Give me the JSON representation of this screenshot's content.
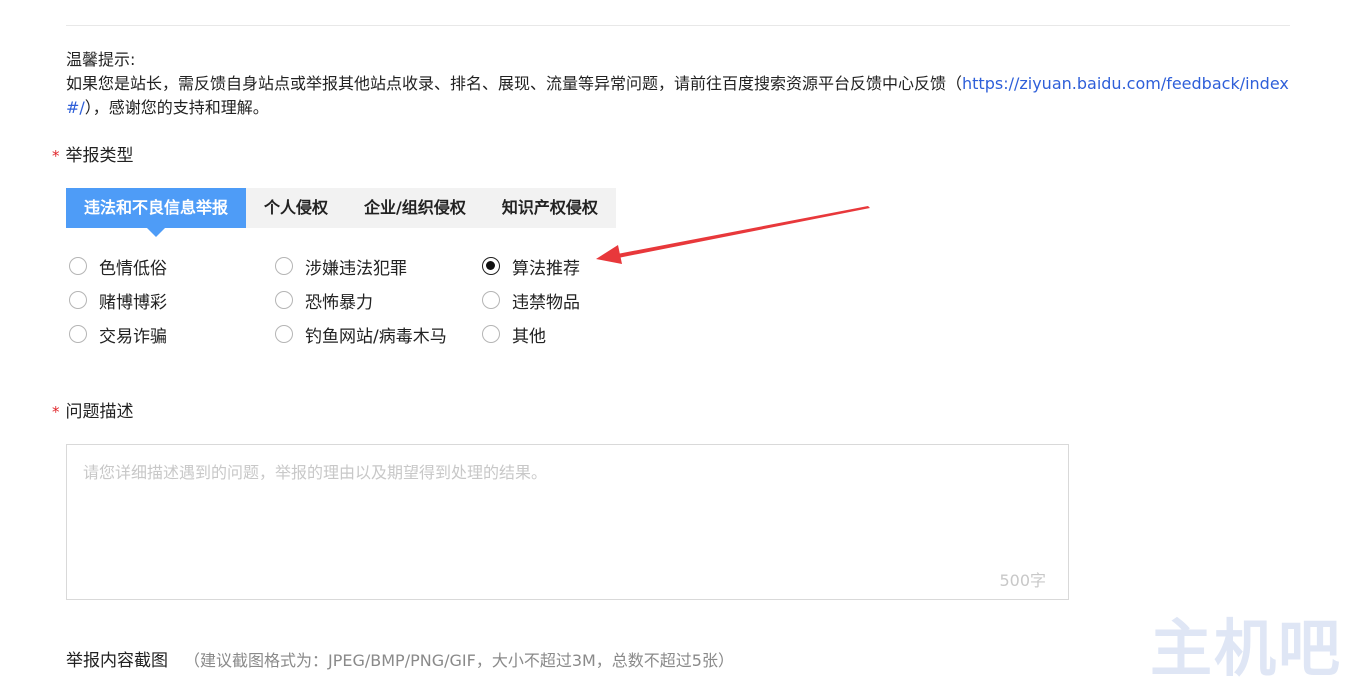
{
  "tip": {
    "title": "温馨提示:",
    "text_before": "如果您是站长，需反馈自身站点或举报其他站点收录、排名、展现、流量等异常问题，请前往百度搜索资源平台反馈中心反馈（",
    "link": "https://ziyuan.baidu.com/feedback/index#/",
    "text_after": "），感谢您的支持和理解。"
  },
  "report_type": {
    "required_mark": "*",
    "label": "举报类型",
    "tabs": [
      {
        "label": "违法和不良信息举报",
        "active": true
      },
      {
        "label": "个人侵权",
        "active": false
      },
      {
        "label": "企业/组织侵权",
        "active": false
      },
      {
        "label": "知识产权侵权",
        "active": false
      }
    ],
    "options": [
      {
        "label": "色情低俗",
        "checked": false
      },
      {
        "label": "涉嫌违法犯罪",
        "checked": false
      },
      {
        "label": "算法推荐",
        "checked": true
      },
      {
        "label": "赌博博彩",
        "checked": false
      },
      {
        "label": "恐怖暴力",
        "checked": false
      },
      {
        "label": "违禁物品",
        "checked": false
      },
      {
        "label": "交易诈骗",
        "checked": false
      },
      {
        "label": "钓鱼网站/病毒木马",
        "checked": false
      },
      {
        "label": "其他",
        "checked": false
      }
    ]
  },
  "description": {
    "required_mark": "*",
    "label": "问题描述",
    "placeholder": "请您详细描述遇到的问题，举报的理由以及期望得到处理的结果。",
    "value": "",
    "counter": "500字"
  },
  "screenshot": {
    "label": "举报内容截图",
    "hint": "（建议截图格式为：JPEG/BMP/PNG/GIF，大小不超过3M，总数不超过5张）"
  },
  "watermark": "主机吧",
  "colors": {
    "accent": "#4e9cf7",
    "required": "#e0262b",
    "link": "#2e5fd9",
    "annotation_arrow": "#e8383b"
  }
}
